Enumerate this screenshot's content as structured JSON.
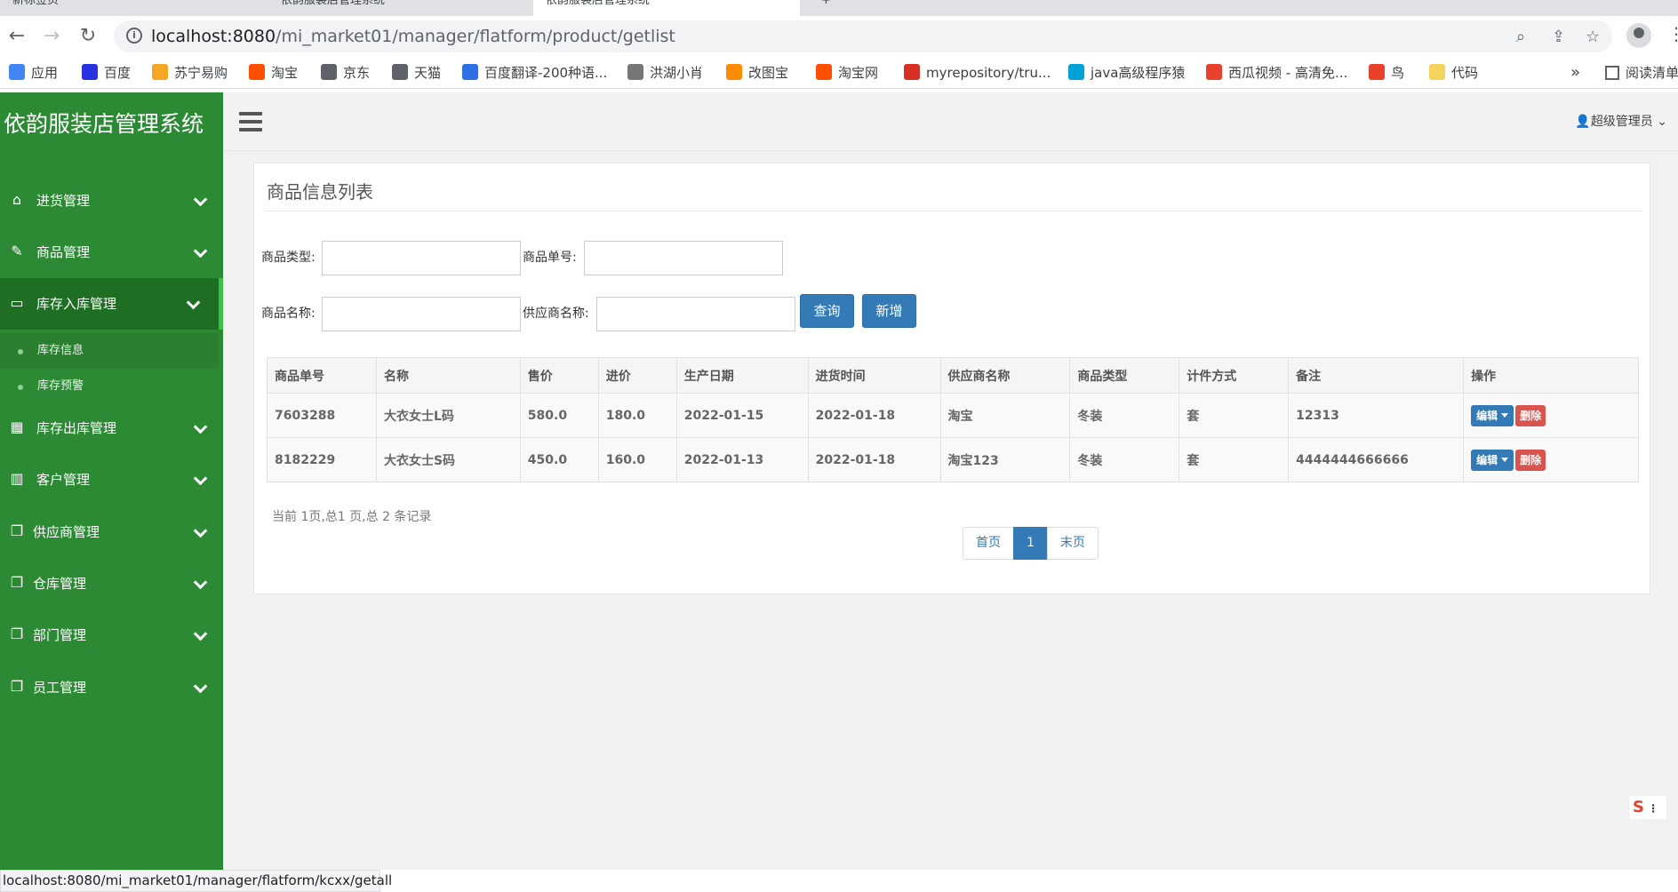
{
  "browser": {
    "tabs": [
      {
        "title": "新标签页"
      },
      {
        "title": "依韵服装店管理系统"
      },
      {
        "title": "依韵服装店管理系统"
      }
    ],
    "url_host": "localhost:8080",
    "url_path": "/mi_market01/manager/flatform/product/getlist",
    "bookmarks": [
      {
        "label": "应用",
        "color": "#4285f4"
      },
      {
        "label": "百度",
        "color": "#2932e1"
      },
      {
        "label": "苏宁易购",
        "color": "#f5a623"
      },
      {
        "label": "淘宝",
        "color": "#ff5000"
      },
      {
        "label": "京东",
        "color": "#5f6368"
      },
      {
        "label": "天猫",
        "color": "#5f6368"
      },
      {
        "label": "百度翻译-200种语...",
        "color": "#2f6fe4"
      },
      {
        "label": "洪湖小肖",
        "color": "#777777"
      },
      {
        "label": "改图宝",
        "color": "#ff8c00"
      },
      {
        "label": "淘宝网",
        "color": "#ff5000"
      },
      {
        "label": "myrepository/tru...",
        "color": "#d93025"
      },
      {
        "label": "java高级程序猿",
        "color": "#00a1d6"
      },
      {
        "label": "西瓜视频 - 高清免...",
        "color": "#e8412c"
      },
      {
        "label": "鸟",
        "color": "#e8412c"
      },
      {
        "label": "代码",
        "color": "#f4d35e"
      }
    ],
    "bookmarks_more": "»",
    "reading_list": "阅读清单",
    "status_url": "localhost:8080/mi_market01/manager/flatform/kcxx/getall"
  },
  "app": {
    "title": "依韵服装店管理系统",
    "user": "超级管理员"
  },
  "sidebar": {
    "items": [
      {
        "label": "进货管理",
        "icon": "home-icon",
        "glyph": "⌂"
      },
      {
        "label": "商品管理",
        "icon": "edit-icon",
        "glyph": "✎"
      },
      {
        "label": "库存入库管理",
        "icon": "monitor-icon",
        "glyph": "▭",
        "active": true
      },
      {
        "label": "库存出库管理",
        "icon": "table-icon",
        "glyph": "▦"
      },
      {
        "label": "客户管理",
        "icon": "bar-chart-icon",
        "glyph": "▥"
      },
      {
        "label": "供应商管理",
        "icon": "copy-icon",
        "glyph": "❐"
      },
      {
        "label": "仓库管理",
        "icon": "copy-icon",
        "glyph": "❐"
      },
      {
        "label": "部门管理",
        "icon": "copy-icon",
        "glyph": "❐"
      },
      {
        "label": "员工管理",
        "icon": "copy-icon",
        "glyph": "❐"
      }
    ],
    "submenu": [
      {
        "label": "库存信息",
        "active": true
      },
      {
        "label": "库存预警"
      }
    ]
  },
  "panel": {
    "title": "商品信息列表"
  },
  "filters": {
    "type_label": "商品类型:",
    "type_value": "",
    "code_label": "商品单号:",
    "code_value": "",
    "name_label": "商品名称:",
    "name_value": "",
    "supplier_label": "供应商名称:",
    "supplier_value": "",
    "query_label": "查询",
    "add_label": "新增"
  },
  "table": {
    "headers": [
      "商品单号",
      "名称",
      "售价",
      "进价",
      "生产日期",
      "进货时间",
      "供应商名称",
      "商品类型",
      "计件方式",
      "备注",
      "操作"
    ],
    "rows": [
      [
        "7603288",
        "大衣女士L码",
        "580.0",
        "180.0",
        "2022-01-15",
        "2022-01-18",
        "淘宝",
        "冬装",
        "套",
        "12313"
      ],
      [
        "8182229",
        "大衣女士S码",
        "450.0",
        "160.0",
        "2022-01-13",
        "2022-01-18",
        "淘宝123",
        "冬装",
        "套",
        "4444444666666"
      ]
    ],
    "edit_label": "编辑",
    "delete_label": "删除"
  },
  "pagination": {
    "info": "当前 1页,总1 页,总 2 条记录",
    "first": "首页",
    "current": "1",
    "last": "末页"
  },
  "ime": {
    "label": "S"
  },
  "colors": {
    "sidebar": "#2d8a34",
    "primary": "#337ab7",
    "danger": "#d9534f"
  }
}
